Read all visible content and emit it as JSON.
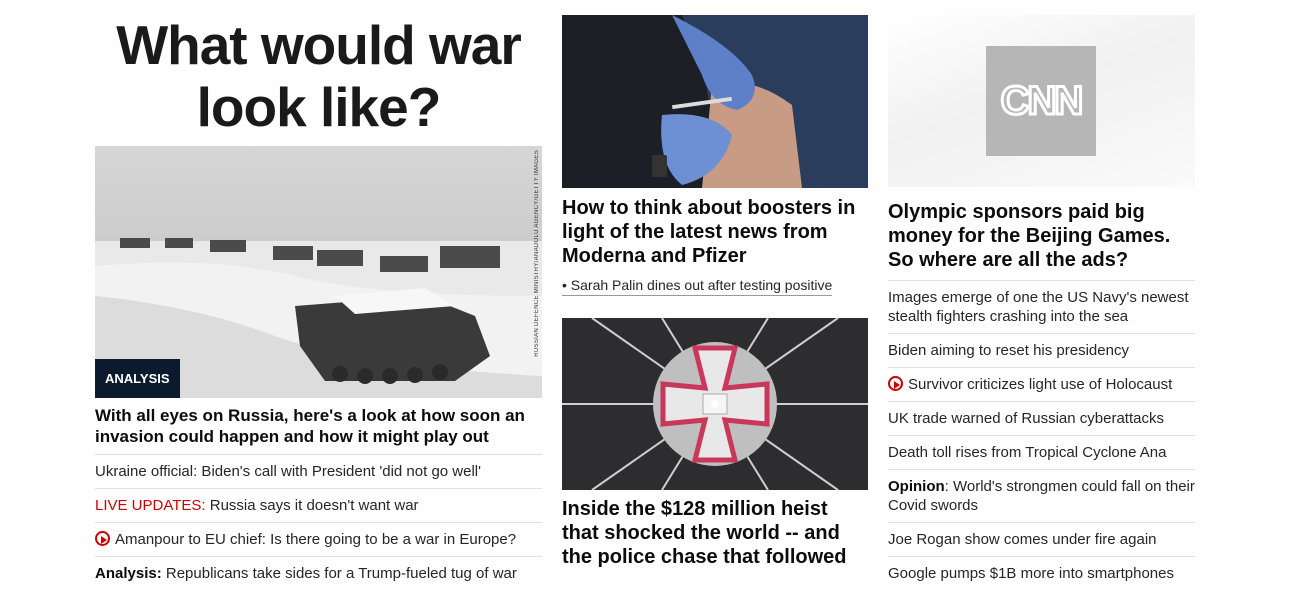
{
  "left": {
    "banner": "What would war look like?",
    "badge": "ANALYSIS",
    "credit": "RUSSIAN DEFENCE MINISTRY/ANADOLU AGENCY/GETTY IMAGES",
    "headline": "With all eyes on Russia, here's a look at how soon an invasion could happen and how it might play out",
    "items": [
      {
        "lead": "",
        "text": "Ukraine official: Biden's call with President 'did not go well'"
      },
      {
        "lead": "LIVE UPDATES:",
        "text": " Russia says it doesn't want war"
      },
      {
        "lead": "",
        "text": "Amanpour to EU chief: Is there going to be a war in Europe?"
      },
      {
        "lead": "Analysis:",
        "text": " Republicans take sides for a Trump-fueled tug of war"
      }
    ]
  },
  "middle": {
    "story1": {
      "headline": "How to think about boosters in light of the latest news from Moderna and Pfizer",
      "sub": "• Sarah Palin dines out after testing positive"
    },
    "story2": {
      "headline": "Inside the $128 million heist that shocked the world -- and the police chase that followed"
    }
  },
  "right": {
    "logo": "CNN",
    "headline": "Olympic sponsors paid big money for the Beijing Games. So where are all the ads?",
    "items": [
      {
        "lead": "",
        "text": "Images emerge of one the US Navy's newest stealth fighters crashing into the sea"
      },
      {
        "lead": "",
        "text": "Biden aiming to reset his presidency"
      },
      {
        "lead": "",
        "text": "Survivor criticizes light use of Holocaust"
      },
      {
        "lead": "",
        "text": "UK trade warned of Russian cyberattacks"
      },
      {
        "lead": "",
        "text": "Death toll rises from Tropical Cyclone Ana"
      },
      {
        "lead": "Opinion",
        "text": ": World's strongmen could fall on their Covid swords"
      },
      {
        "lead": "",
        "text": "Joe Rogan show comes under fire again"
      },
      {
        "lead": "",
        "text": "Google pumps $1B more into smartphones"
      }
    ]
  },
  "colors": {
    "accent": "#cc0000",
    "badge_bg": "#0c1a2e",
    "divider": "#e0e0e0"
  }
}
